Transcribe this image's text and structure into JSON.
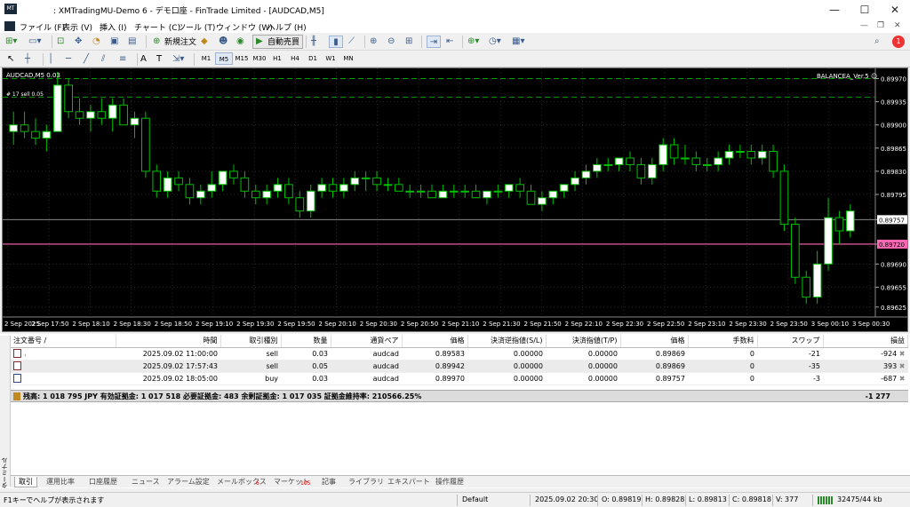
{
  "window": {
    "title": ": XMTradingMU-Demo 6 - デモ口座 - FinTrade Limited - [AUDCAD,M5]",
    "app_icon": "mt-logo-icon",
    "minimize": "—",
    "maximize": "☐",
    "close": "✕"
  },
  "menu": [
    "ファイル (F)",
    "表示 (V)",
    "挿入 (I)",
    "チャート (C)",
    "ツール (T)",
    "ウィンドウ (W)",
    "ヘルプ (H)"
  ],
  "toolbar": {
    "new_order": "新規注文",
    "auto_trade": "自動売買",
    "notification_count": "1"
  },
  "timeframes": [
    "M1",
    "M5",
    "M15",
    "M30",
    "H1",
    "H4",
    "D1",
    "W1",
    "MN"
  ],
  "active_timeframe": "M5",
  "chart": {
    "symbol_label": "AUDCAD,M5  0.03",
    "indicator_label": "BALANCEA_Ver.5 ☺",
    "order_label": "#  17 sell 0.05",
    "price_ticks": [
      "0.89970",
      "0.89935",
      "0.89900",
      "0.89865",
      "0.89830",
      "0.89795",
      "0.89757",
      "0.89720",
      "0.89690",
      "0.89655",
      "0.89625"
    ],
    "current_bid": "0.89757",
    "pink_line_price": "0.89720",
    "time_ticks": [
      "2 Sep 2025",
      "2 Sep 17:50",
      "2 Sep 18:10",
      "2 Sep 18:30",
      "2 Sep 18:50",
      "2 Sep 19:10",
      "2 Sep 19:30",
      "2 Sep 19:50",
      "2 Sep 20:10",
      "2 Sep 20:30",
      "2 Sep 20:50",
      "2 Sep 21:10",
      "2 Sep 21:30",
      "2 Sep 21:50",
      "2 Sep 22:10",
      "2 Sep 22:30",
      "2 Sep 22:50",
      "2 Sep 23:10",
      "2 Sep 23:30",
      "2 Sep 23:50",
      "3 Sep 00:10",
      "3 Sep 00:30"
    ],
    "bg_color": "#000000",
    "bull_color": "#ffffff",
    "bear_color": "#000000",
    "wick_color": "#00c000",
    "pink_color": "#ff69b4"
  },
  "chart_data": {
    "type": "candlestick",
    "ylim": [
      0.8961,
      0.8998
    ],
    "candles": [
      [
        0.8989,
        0.8992,
        0.8987,
        0.899
      ],
      [
        0.899,
        0.8992,
        0.8988,
        0.8989
      ],
      [
        0.8989,
        0.8991,
        0.8987,
        0.8988
      ],
      [
        0.8988,
        0.899,
        0.8986,
        0.8989
      ],
      [
        0.8989,
        0.8998,
        0.8989,
        0.8996
      ],
      [
        0.8996,
        0.8997,
        0.8991,
        0.8992
      ],
      [
        0.8992,
        0.8994,
        0.899,
        0.8991
      ],
      [
        0.8991,
        0.8993,
        0.8989,
        0.8992
      ],
      [
        0.8992,
        0.8994,
        0.899,
        0.8991
      ],
      [
        0.8991,
        0.8994,
        0.8989,
        0.8993
      ],
      [
        0.8993,
        0.8994,
        0.899,
        0.899
      ],
      [
        0.899,
        0.8992,
        0.8988,
        0.8991
      ],
      [
        0.8991,
        0.8992,
        0.8982,
        0.8983
      ],
      [
        0.8983,
        0.8984,
        0.8979,
        0.898
      ],
      [
        0.898,
        0.8983,
        0.8979,
        0.8982
      ],
      [
        0.8982,
        0.8983,
        0.898,
        0.8981
      ],
      [
        0.8981,
        0.8982,
        0.8978,
        0.8979
      ],
      [
        0.8979,
        0.8981,
        0.8978,
        0.898
      ],
      [
        0.898,
        0.8983,
        0.8979,
        0.8981
      ],
      [
        0.8981,
        0.8983,
        0.898,
        0.8983
      ],
      [
        0.8983,
        0.8984,
        0.8981,
        0.8982
      ],
      [
        0.8982,
        0.8983,
        0.8979,
        0.898
      ],
      [
        0.898,
        0.8981,
        0.8978,
        0.8979
      ],
      [
        0.8979,
        0.8981,
        0.8978,
        0.898
      ],
      [
        0.898,
        0.8982,
        0.8979,
        0.8981
      ],
      [
        0.8981,
        0.8982,
        0.8978,
        0.8979
      ],
      [
        0.8979,
        0.898,
        0.8976,
        0.8977
      ],
      [
        0.8977,
        0.8981,
        0.8976,
        0.898
      ],
      [
        0.898,
        0.8982,
        0.8979,
        0.8981
      ],
      [
        0.8981,
        0.8982,
        0.8979,
        0.898
      ],
      [
        0.898,
        0.8982,
        0.8979,
        0.8981
      ],
      [
        0.8981,
        0.8983,
        0.898,
        0.8982
      ],
      [
        0.8982,
        0.8983,
        0.898,
        0.8982
      ],
      [
        0.8982,
        0.8983,
        0.898,
        0.8981
      ],
      [
        0.8981,
        0.8982,
        0.898,
        0.8981
      ],
      [
        0.8981,
        0.8982,
        0.898,
        0.898
      ],
      [
        0.898,
        0.8981,
        0.8979,
        0.898
      ],
      [
        0.898,
        0.8981,
        0.8979,
        0.898
      ],
      [
        0.898,
        0.8981,
        0.8979,
        0.8979
      ],
      [
        0.8979,
        0.8981,
        0.8979,
        0.898
      ],
      [
        0.898,
        0.8981,
        0.8979,
        0.898
      ],
      [
        0.898,
        0.8981,
        0.8979,
        0.898
      ],
      [
        0.898,
        0.8981,
        0.8979,
        0.8979
      ],
      [
        0.8979,
        0.898,
        0.8978,
        0.898
      ],
      [
        0.898,
        0.8981,
        0.8979,
        0.898
      ],
      [
        0.898,
        0.8981,
        0.8979,
        0.8981
      ],
      [
        0.8981,
        0.8982,
        0.8979,
        0.898
      ],
      [
        0.898,
        0.8981,
        0.8978,
        0.8978
      ],
      [
        0.8978,
        0.898,
        0.8977,
        0.8979
      ],
      [
        0.8979,
        0.898,
        0.8978,
        0.898
      ],
      [
        0.898,
        0.8981,
        0.8979,
        0.8981
      ],
      [
        0.8981,
        0.8983,
        0.898,
        0.8982
      ],
      [
        0.8982,
        0.8984,
        0.8981,
        0.8983
      ],
      [
        0.8983,
        0.8985,
        0.8982,
        0.8984
      ],
      [
        0.8984,
        0.8985,
        0.8983,
        0.8984
      ],
      [
        0.8984,
        0.8985,
        0.8983,
        0.8985
      ],
      [
        0.8985,
        0.8986,
        0.8983,
        0.8984
      ],
      [
        0.8984,
        0.8985,
        0.8981,
        0.8982
      ],
      [
        0.8982,
        0.8985,
        0.8981,
        0.8984
      ],
      [
        0.8984,
        0.8988,
        0.8983,
        0.8987
      ],
      [
        0.8987,
        0.8988,
        0.8984,
        0.8985
      ],
      [
        0.8985,
        0.8987,
        0.8984,
        0.8985
      ],
      [
        0.8985,
        0.8986,
        0.8983,
        0.8984
      ],
      [
        0.8984,
        0.8985,
        0.8983,
        0.8984
      ],
      [
        0.8984,
        0.8986,
        0.8983,
        0.8985
      ],
      [
        0.8985,
        0.8987,
        0.8984,
        0.8986
      ],
      [
        0.8986,
        0.8987,
        0.8985,
        0.8986
      ],
      [
        0.8986,
        0.8987,
        0.8984,
        0.8985
      ],
      [
        0.8985,
        0.8987,
        0.8984,
        0.8986
      ],
      [
        0.8986,
        0.8987,
        0.8982,
        0.8983
      ],
      [
        0.8983,
        0.8984,
        0.8974,
        0.8975
      ],
      [
        0.8975,
        0.8976,
        0.8966,
        0.8967
      ],
      [
        0.8967,
        0.8968,
        0.8963,
        0.8964
      ],
      [
        0.8964,
        0.8971,
        0.8963,
        0.8969
      ],
      [
        0.8969,
        0.8979,
        0.8968,
        0.8976
      ],
      [
        0.8976,
        0.8977,
        0.8972,
        0.8974
      ],
      [
        0.8974,
        0.8978,
        0.8973,
        0.8977
      ]
    ]
  },
  "terminal": {
    "side_label": "ターミナル",
    "columns": [
      "注文番号  /",
      "時間",
      "取引種別",
      "数量",
      "通貨ペア",
      "価格",
      "決済逆指値(S/L)",
      "決済指値(T/P)",
      "価格",
      "手数料",
      "スワップ",
      "損益"
    ],
    "rows": [
      {
        "id": ".",
        "time": "2025.09.02 11:00:00",
        "type": "sell",
        "volume": "0.03",
        "symbol": "audcad",
        "price": "0.89583",
        "sl": "0.00000",
        "tp": "0.00000",
        "cur": "0.89869",
        "commission": "0",
        "swap": "-21",
        "profit": "-924"
      },
      {
        "id": "",
        "time": "2025.09.02 17:57:43",
        "type": "sell",
        "volume": "0.05",
        "symbol": "audcad",
        "price": "0.89942",
        "sl": "0.00000",
        "tp": "0.00000",
        "cur": "0.89869",
        "commission": "0",
        "swap": "-35",
        "profit": "393"
      },
      {
        "id": "",
        "time": "2025.09.02 18:05:00",
        "type": "buy",
        "volume": "0.03",
        "symbol": "audcad",
        "price": "0.89970",
        "sl": "0.00000",
        "tp": "0.00000",
        "cur": "0.89757",
        "commission": "0",
        "swap": "-3",
        "profit": "-687"
      }
    ],
    "balance_text": "残高: 1 018 795 JPY  有効証拠金: 1 017 518  必要証拠金: 483  余剰証拠金: 1 017 035  証拠金維持率: 210566.25%",
    "total_profit": "-1 277",
    "tabs": [
      "取引",
      "運用比率",
      "口座履歴",
      "ニュース",
      "アラーム設定",
      "メールボックス",
      "マーケット",
      "記事",
      "ライブラリ",
      "エキスパート",
      "操作履歴"
    ],
    "mailbox_badge": "6",
    "market_badge": "105"
  },
  "status": {
    "help": "F1キーでヘルプが表示されます",
    "profile": "Default",
    "datetime": "2025.09.02 20:30",
    "open": "O: 0.89819",
    "high": "H: 0.89828",
    "low": "L: 0.89813",
    "close": "C: 0.89818",
    "volume": "V: 377",
    "traffic": "32475/44 kb"
  }
}
